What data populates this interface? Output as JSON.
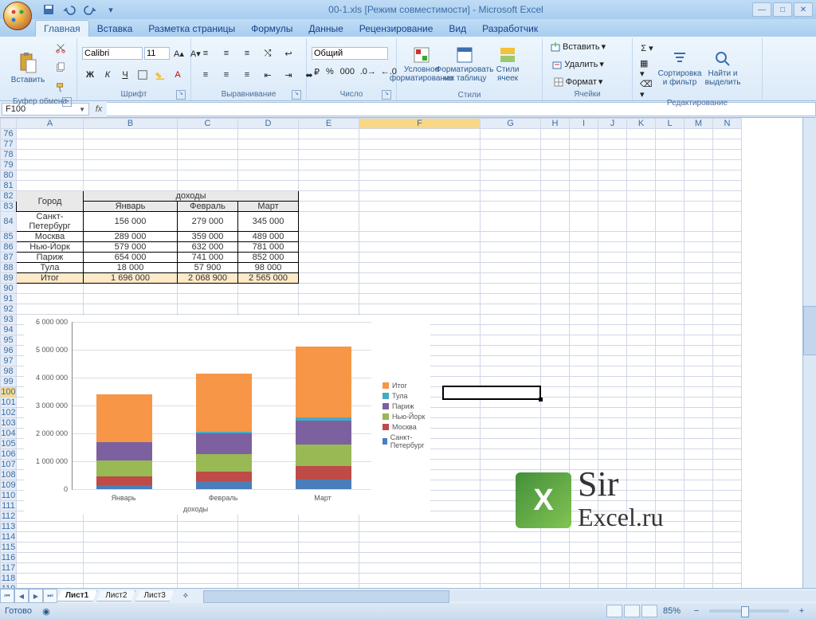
{
  "title": "00-1.xls  [Режим совместимости] - Microsoft Excel",
  "qat": [
    "save",
    "undo",
    "redo",
    "dropdown"
  ],
  "tabs": [
    "Главная",
    "Вставка",
    "Разметка страницы",
    "Формулы",
    "Данные",
    "Рецензирование",
    "Вид",
    "Разработчик"
  ],
  "active_tab": 0,
  "ribbon": {
    "clipboard": {
      "paste": "Вставить",
      "label": "Буфер обмена"
    },
    "font": {
      "name": "Calibri",
      "size": "11",
      "label": "Шрифт"
    },
    "align": {
      "label": "Выравнивание"
    },
    "number": {
      "format": "Общий",
      "label": "Число"
    },
    "styles": {
      "cond": "Условное форматирование",
      "table": "Форматировать как таблицу",
      "cell": "Стили ячеек",
      "label": "Стили"
    },
    "cells": {
      "insert": "Вставить",
      "delete": "Удалить",
      "format": "Формат",
      "label": "Ячейки"
    },
    "editing": {
      "sort": "Сортировка и фильтр",
      "find": "Найти и выделить",
      "label": "Редактирование"
    }
  },
  "namebox": "F100",
  "formula": "",
  "cols": [
    "A",
    "B",
    "C",
    "D",
    "E",
    "F",
    "G",
    "H",
    "I",
    "J",
    "K",
    "L",
    "M",
    "N"
  ],
  "row_start": 76,
  "row_end": 119,
  "selected_col": "F",
  "selected_row": 100,
  "table": {
    "header_city": "Город",
    "header_income": "доходы",
    "months": [
      "Январь",
      "Февраль",
      "Март"
    ],
    "rows": [
      {
        "city": "Санкт-Петербург",
        "v": [
          "156 000",
          "279 000",
          "345 000"
        ]
      },
      {
        "city": "Москва",
        "v": [
          "289 000",
          "359 000",
          "489 000"
        ]
      },
      {
        "city": "Нью-Йорк",
        "v": [
          "579 000",
          "632 000",
          "781 000"
        ]
      },
      {
        "city": "Париж",
        "v": [
          "654 000",
          "741 000",
          "852 000"
        ]
      },
      {
        "city": "Тула",
        "v": [
          "18 000",
          "57 900",
          "98 000"
        ]
      }
    ],
    "total": {
      "label": "Итог",
      "v": [
        "1 696 000",
        "2 068 900",
        "2 565 000"
      ]
    }
  },
  "chart_data": {
    "type": "bar",
    "stacked": true,
    "categories": [
      "Январь",
      "Февраль",
      "Март"
    ],
    "series": [
      {
        "name": "Санкт-Петербург",
        "values": [
          156000,
          279000,
          345000
        ],
        "color": "#4a7ebb"
      },
      {
        "name": "Москва",
        "values": [
          289000,
          359000,
          489000
        ],
        "color": "#be4b48"
      },
      {
        "name": "Нью-Йорк",
        "values": [
          579000,
          632000,
          781000
        ],
        "color": "#98b954"
      },
      {
        "name": "Париж",
        "values": [
          654000,
          741000,
          852000
        ],
        "color": "#7d60a0"
      },
      {
        "name": "Тула",
        "values": [
          18000,
          57900,
          98000
        ],
        "color": "#46aac5"
      },
      {
        "name": "Итог",
        "values": [
          1696000,
          2068900,
          2565000
        ],
        "color": "#f79646"
      }
    ],
    "legend_order": [
      "Итог",
      "Тула",
      "Париж",
      "Нью-Йорк",
      "Москва",
      "Санкт-Петербург"
    ],
    "xlabel": "доходы",
    "ylabel": "",
    "ylim": [
      0,
      6000000
    ],
    "yticks": [
      0,
      1000000,
      2000000,
      3000000,
      4000000,
      5000000,
      6000000
    ],
    "ytick_labels": [
      "0",
      "1 000 000",
      "2 000 000",
      "3 000 000",
      "4 000 000",
      "5 000 000",
      "6 000 000"
    ]
  },
  "watermark": {
    "line1": "Sir",
    "line2": "Excel.ru"
  },
  "sheet_tabs": [
    "Лист1",
    "Лист2",
    "Лист3"
  ],
  "active_sheet": 0,
  "status": "Готово",
  "zoom": "85%"
}
